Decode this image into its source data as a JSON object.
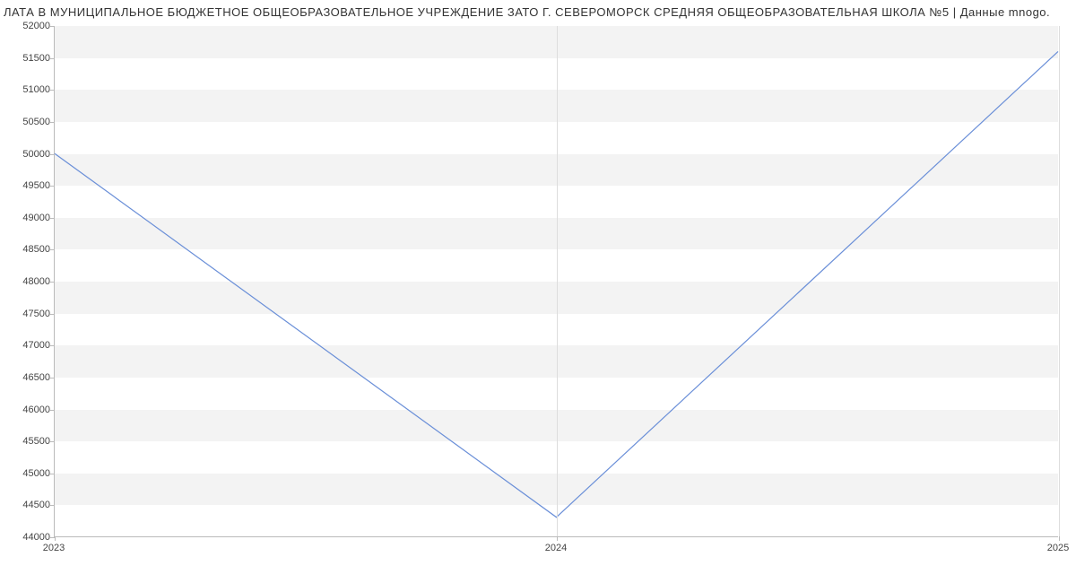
{
  "chart_data": {
    "type": "line",
    "title": "ЛАТА В МУНИЦИПАЛЬНОЕ БЮДЖЕТНОЕ ОБЩЕОБРАЗОВАТЕЛЬНОЕ УЧРЕЖДЕНИЕ ЗАТО Г. СЕВЕРОМОРСК СРЕДНЯЯ ОБЩЕОБРАЗОВАТЕЛЬНАЯ ШКОЛА №5 | Данные mnogo.",
    "x": [
      "2023",
      "2024",
      "2025"
    ],
    "values": [
      50000,
      44300,
      51600
    ],
    "xlabel": "",
    "ylabel": "",
    "ylim": [
      44000,
      52000
    ],
    "y_ticks": [
      44000,
      44500,
      45000,
      45500,
      46000,
      46500,
      47000,
      47500,
      48000,
      48500,
      49000,
      49500,
      50000,
      50500,
      51000,
      51500,
      52000
    ],
    "line_color": "#6a8fd8"
  }
}
